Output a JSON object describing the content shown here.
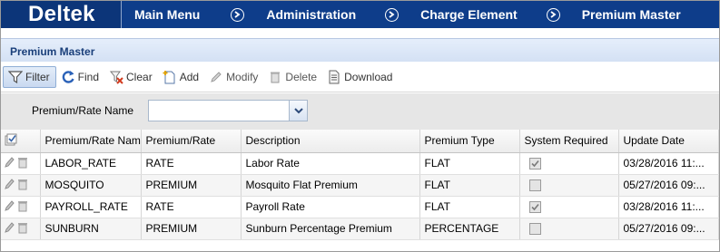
{
  "nav": {
    "brand": "Deltek",
    "breadcrumbs": [
      "Main Menu",
      "Administration",
      "Charge Element",
      "Premium Master"
    ]
  },
  "panel": {
    "title": "Premium Master"
  },
  "toolbar": {
    "filter": "Filter",
    "find": "Find",
    "clear": "Clear",
    "add": "Add",
    "modify": "Modify",
    "delete": "Delete",
    "download": "Download"
  },
  "search": {
    "label": "Premium/Rate Name",
    "value": ""
  },
  "grid": {
    "columns": [
      "Premium/Rate Name",
      "Premium/Rate",
      "Description",
      "Premium Type",
      "System Required",
      "Update Date"
    ],
    "rows": [
      {
        "name": "LABOR_RATE",
        "rate": "RATE",
        "description": "Labor Rate",
        "type": "FLAT",
        "system_required": true,
        "update_date": "03/28/2016 11:..."
      },
      {
        "name": "MOSQUITO",
        "rate": "PREMIUM",
        "description": "Mosquito Flat Premium",
        "type": "FLAT",
        "system_required": false,
        "update_date": "05/27/2016 09:..."
      },
      {
        "name": "PAYROLL_RATE",
        "rate": "RATE",
        "description": "Payroll Rate",
        "type": "FLAT",
        "system_required": true,
        "update_date": "03/28/2016 11:..."
      },
      {
        "name": "SUNBURN",
        "rate": "PREMIUM",
        "description": "Sunburn Percentage Premium",
        "type": "PERCENTAGE",
        "system_required": false,
        "update_date": "05/27/2016 09:..."
      }
    ]
  },
  "colors": {
    "nav_bg": "#0e3d8a",
    "brand_bg": "#0c3579",
    "panel_title": "#1a3f7a"
  }
}
